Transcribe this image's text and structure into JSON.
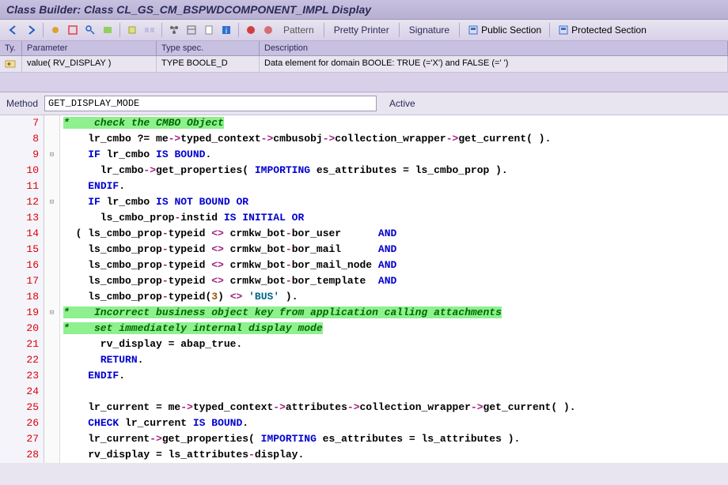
{
  "title": "Class Builder: Class CL_GS_CM_BSPWDCOMPONENT_IMPL Display",
  "toolbar": {
    "pattern": "Pattern",
    "pretty": "Pretty Printer",
    "signature": "Signature",
    "public": "Public Section",
    "protected": "Protected Section"
  },
  "paramHeader": {
    "ty": "Ty.",
    "param": "Parameter",
    "typespec": "Type spec.",
    "desc": "Description"
  },
  "paramRow": {
    "param": "value( RV_DISPLAY )",
    "typespec": "TYPE BOOLE_D",
    "desc": "Data element for domain BOOLE: TRUE (='X') and FALSE (=' ')"
  },
  "method": {
    "label": "Method",
    "value": "GET_DISPLAY_MODE",
    "status": "Active"
  },
  "lines": [
    {
      "n": 7,
      "fold": "",
      "seg": [
        {
          "t": "*    check the CMBO Object",
          "c": "hl-comment"
        }
      ]
    },
    {
      "n": 8,
      "fold": "",
      "seg": [
        {
          "t": "    lr_cmbo ?= me",
          "c": "id"
        },
        {
          "t": "->",
          "c": "op"
        },
        {
          "t": "typed_context",
          "c": "id"
        },
        {
          "t": "->",
          "c": "op"
        },
        {
          "t": "cmbusobj",
          "c": "id"
        },
        {
          "t": "->",
          "c": "op"
        },
        {
          "t": "collection_wrapper",
          "c": "id"
        },
        {
          "t": "->",
          "c": "op"
        },
        {
          "t": "get_current",
          "c": "id"
        },
        {
          "t": "( ).",
          "c": "id"
        }
      ]
    },
    {
      "n": 9,
      "fold": "⊟",
      "seg": [
        {
          "t": "    ",
          "c": ""
        },
        {
          "t": "IF",
          "c": "kw"
        },
        {
          "t": " lr_cmbo ",
          "c": "id"
        },
        {
          "t": "IS BOUND",
          "c": "kw"
        },
        {
          "t": ".",
          "c": "id"
        }
      ]
    },
    {
      "n": 10,
      "fold": "",
      "seg": [
        {
          "t": "      lr_cmbo",
          "c": "id"
        },
        {
          "t": "->",
          "c": "op"
        },
        {
          "t": "get_properties",
          "c": "id"
        },
        {
          "t": "( ",
          "c": "id"
        },
        {
          "t": "IMPORTING",
          "c": "kw"
        },
        {
          "t": " es_attributes = ls_cmbo_prop ).",
          "c": "id"
        }
      ]
    },
    {
      "n": 11,
      "fold": "",
      "seg": [
        {
          "t": "    ",
          "c": ""
        },
        {
          "t": "ENDIF",
          "c": "kw"
        },
        {
          "t": ".",
          "c": "id"
        }
      ]
    },
    {
      "n": 12,
      "fold": "⊟",
      "seg": [
        {
          "t": "    ",
          "c": ""
        },
        {
          "t": "IF",
          "c": "kw"
        },
        {
          "t": " lr_cmbo ",
          "c": "id"
        },
        {
          "t": "IS NOT BOUND OR",
          "c": "kw"
        }
      ]
    },
    {
      "n": 13,
      "fold": "",
      "seg": [
        {
          "t": "      ls_cmbo_prop",
          "c": "id"
        },
        {
          "t": "-",
          "c": "op"
        },
        {
          "t": "instid ",
          "c": "id"
        },
        {
          "t": "IS INITIAL OR",
          "c": "kw"
        }
      ]
    },
    {
      "n": 14,
      "fold": "",
      "seg": [
        {
          "t": "  ( ls_cmbo_prop",
          "c": "id"
        },
        {
          "t": "-",
          "c": "op"
        },
        {
          "t": "typeid ",
          "c": "id"
        },
        {
          "t": "<>",
          "c": "op"
        },
        {
          "t": " crmkw_bot",
          "c": "id"
        },
        {
          "t": "-",
          "c": "op"
        },
        {
          "t": "bor_user      ",
          "c": "id"
        },
        {
          "t": "AND",
          "c": "kw"
        }
      ]
    },
    {
      "n": 15,
      "fold": "",
      "seg": [
        {
          "t": "    ls_cmbo_prop",
          "c": "id"
        },
        {
          "t": "-",
          "c": "op"
        },
        {
          "t": "typeid ",
          "c": "id"
        },
        {
          "t": "<>",
          "c": "op"
        },
        {
          "t": " crmkw_bot",
          "c": "id"
        },
        {
          "t": "-",
          "c": "op"
        },
        {
          "t": "bor_mail      ",
          "c": "id"
        },
        {
          "t": "AND",
          "c": "kw"
        }
      ]
    },
    {
      "n": 16,
      "fold": "",
      "seg": [
        {
          "t": "    ls_cmbo_prop",
          "c": "id"
        },
        {
          "t": "-",
          "c": "op"
        },
        {
          "t": "typeid ",
          "c": "id"
        },
        {
          "t": "<>",
          "c": "op"
        },
        {
          "t": " crmkw_bot",
          "c": "id"
        },
        {
          "t": "-",
          "c": "op"
        },
        {
          "t": "bor_mail_node ",
          "c": "id"
        },
        {
          "t": "AND",
          "c": "kw"
        }
      ]
    },
    {
      "n": 17,
      "fold": "",
      "seg": [
        {
          "t": "    ls_cmbo_prop",
          "c": "id"
        },
        {
          "t": "-",
          "c": "op"
        },
        {
          "t": "typeid ",
          "c": "id"
        },
        {
          "t": "<>",
          "c": "op"
        },
        {
          "t": " crmkw_bot",
          "c": "id"
        },
        {
          "t": "-",
          "c": "op"
        },
        {
          "t": "bor_template  ",
          "c": "id"
        },
        {
          "t": "AND",
          "c": "kw"
        }
      ]
    },
    {
      "n": 18,
      "fold": "",
      "seg": [
        {
          "t": "    ls_cmbo_prop",
          "c": "id"
        },
        {
          "t": "-",
          "c": "op"
        },
        {
          "t": "typeid",
          "c": "id"
        },
        {
          "t": "(",
          "c": "id"
        },
        {
          "t": "3",
          "c": "num"
        },
        {
          "t": ") ",
          "c": "id"
        },
        {
          "t": "<>",
          "c": "op"
        },
        {
          "t": " ",
          "c": ""
        },
        {
          "t": "'BUS'",
          "c": "str"
        },
        {
          "t": " ).",
          "c": "id"
        }
      ]
    },
    {
      "n": 19,
      "fold": "⊟",
      "seg": [
        {
          "t": "*    Incorrect business object key from application calling attachments",
          "c": "hl-comment"
        }
      ]
    },
    {
      "n": 20,
      "fold": "",
      "seg": [
        {
          "t": "*    set immediately internal display mode",
          "c": "hl-comment"
        }
      ]
    },
    {
      "n": 21,
      "fold": "",
      "seg": [
        {
          "t": "      rv_display = abap_true.",
          "c": "id"
        }
      ]
    },
    {
      "n": 22,
      "fold": "",
      "seg": [
        {
          "t": "      ",
          "c": ""
        },
        {
          "t": "RETURN",
          "c": "kw"
        },
        {
          "t": ".",
          "c": "id"
        }
      ]
    },
    {
      "n": 23,
      "fold": "",
      "seg": [
        {
          "t": "    ",
          "c": ""
        },
        {
          "t": "ENDIF",
          "c": "kw"
        },
        {
          "t": ".",
          "c": "id"
        }
      ]
    },
    {
      "n": 24,
      "fold": "",
      "seg": [
        {
          "t": " ",
          "c": ""
        }
      ]
    },
    {
      "n": 25,
      "fold": "",
      "seg": [
        {
          "t": "    lr_current = me",
          "c": "id"
        },
        {
          "t": "->",
          "c": "op"
        },
        {
          "t": "typed_context",
          "c": "id"
        },
        {
          "t": "->",
          "c": "op"
        },
        {
          "t": "attributes",
          "c": "id"
        },
        {
          "t": "->",
          "c": "op"
        },
        {
          "t": "collection_wrapper",
          "c": "id"
        },
        {
          "t": "->",
          "c": "op"
        },
        {
          "t": "get_current",
          "c": "id"
        },
        {
          "t": "( ).",
          "c": "id"
        }
      ]
    },
    {
      "n": 26,
      "fold": "",
      "seg": [
        {
          "t": "    ",
          "c": ""
        },
        {
          "t": "CHECK",
          "c": "kw"
        },
        {
          "t": " lr_current ",
          "c": "id"
        },
        {
          "t": "IS BOUND",
          "c": "kw"
        },
        {
          "t": ".",
          "c": "id"
        }
      ]
    },
    {
      "n": 27,
      "fold": "",
      "seg": [
        {
          "t": "    lr_current",
          "c": "id"
        },
        {
          "t": "->",
          "c": "op"
        },
        {
          "t": "get_properties",
          "c": "id"
        },
        {
          "t": "( ",
          "c": "id"
        },
        {
          "t": "IMPORTING",
          "c": "kw"
        },
        {
          "t": " es_attributes = ls_attributes ).",
          "c": "id"
        }
      ]
    },
    {
      "n": 28,
      "fold": "",
      "seg": [
        {
          "t": "    rv_display = ls_attributes",
          "c": "id"
        },
        {
          "t": "-",
          "c": "op"
        },
        {
          "t": "display.",
          "c": "id"
        }
      ]
    }
  ]
}
